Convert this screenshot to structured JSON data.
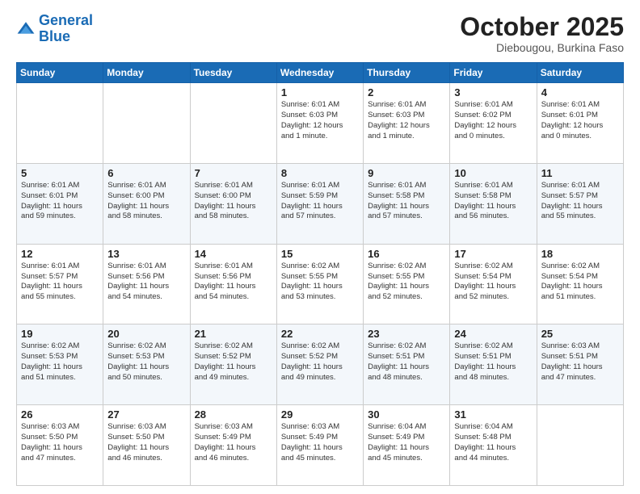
{
  "header": {
    "logo_line1": "General",
    "logo_line2": "Blue",
    "month_title": "October 2025",
    "location": "Diebougou, Burkina Faso"
  },
  "days_of_week": [
    "Sunday",
    "Monday",
    "Tuesday",
    "Wednesday",
    "Thursday",
    "Friday",
    "Saturday"
  ],
  "weeks": [
    [
      {
        "day": "",
        "info": ""
      },
      {
        "day": "",
        "info": ""
      },
      {
        "day": "",
        "info": ""
      },
      {
        "day": "1",
        "info": "Sunrise: 6:01 AM\nSunset: 6:03 PM\nDaylight: 12 hours\nand 1 minute."
      },
      {
        "day": "2",
        "info": "Sunrise: 6:01 AM\nSunset: 6:03 PM\nDaylight: 12 hours\nand 1 minute."
      },
      {
        "day": "3",
        "info": "Sunrise: 6:01 AM\nSunset: 6:02 PM\nDaylight: 12 hours\nand 0 minutes."
      },
      {
        "day": "4",
        "info": "Sunrise: 6:01 AM\nSunset: 6:01 PM\nDaylight: 12 hours\nand 0 minutes."
      }
    ],
    [
      {
        "day": "5",
        "info": "Sunrise: 6:01 AM\nSunset: 6:01 PM\nDaylight: 11 hours\nand 59 minutes."
      },
      {
        "day": "6",
        "info": "Sunrise: 6:01 AM\nSunset: 6:00 PM\nDaylight: 11 hours\nand 58 minutes."
      },
      {
        "day": "7",
        "info": "Sunrise: 6:01 AM\nSunset: 6:00 PM\nDaylight: 11 hours\nand 58 minutes."
      },
      {
        "day": "8",
        "info": "Sunrise: 6:01 AM\nSunset: 5:59 PM\nDaylight: 11 hours\nand 57 minutes."
      },
      {
        "day": "9",
        "info": "Sunrise: 6:01 AM\nSunset: 5:58 PM\nDaylight: 11 hours\nand 57 minutes."
      },
      {
        "day": "10",
        "info": "Sunrise: 6:01 AM\nSunset: 5:58 PM\nDaylight: 11 hours\nand 56 minutes."
      },
      {
        "day": "11",
        "info": "Sunrise: 6:01 AM\nSunset: 5:57 PM\nDaylight: 11 hours\nand 55 minutes."
      }
    ],
    [
      {
        "day": "12",
        "info": "Sunrise: 6:01 AM\nSunset: 5:57 PM\nDaylight: 11 hours\nand 55 minutes."
      },
      {
        "day": "13",
        "info": "Sunrise: 6:01 AM\nSunset: 5:56 PM\nDaylight: 11 hours\nand 54 minutes."
      },
      {
        "day": "14",
        "info": "Sunrise: 6:01 AM\nSunset: 5:56 PM\nDaylight: 11 hours\nand 54 minutes."
      },
      {
        "day": "15",
        "info": "Sunrise: 6:02 AM\nSunset: 5:55 PM\nDaylight: 11 hours\nand 53 minutes."
      },
      {
        "day": "16",
        "info": "Sunrise: 6:02 AM\nSunset: 5:55 PM\nDaylight: 11 hours\nand 52 minutes."
      },
      {
        "day": "17",
        "info": "Sunrise: 6:02 AM\nSunset: 5:54 PM\nDaylight: 11 hours\nand 52 minutes."
      },
      {
        "day": "18",
        "info": "Sunrise: 6:02 AM\nSunset: 5:54 PM\nDaylight: 11 hours\nand 51 minutes."
      }
    ],
    [
      {
        "day": "19",
        "info": "Sunrise: 6:02 AM\nSunset: 5:53 PM\nDaylight: 11 hours\nand 51 minutes."
      },
      {
        "day": "20",
        "info": "Sunrise: 6:02 AM\nSunset: 5:53 PM\nDaylight: 11 hours\nand 50 minutes."
      },
      {
        "day": "21",
        "info": "Sunrise: 6:02 AM\nSunset: 5:52 PM\nDaylight: 11 hours\nand 49 minutes."
      },
      {
        "day": "22",
        "info": "Sunrise: 6:02 AM\nSunset: 5:52 PM\nDaylight: 11 hours\nand 49 minutes."
      },
      {
        "day": "23",
        "info": "Sunrise: 6:02 AM\nSunset: 5:51 PM\nDaylight: 11 hours\nand 48 minutes."
      },
      {
        "day": "24",
        "info": "Sunrise: 6:02 AM\nSunset: 5:51 PM\nDaylight: 11 hours\nand 48 minutes."
      },
      {
        "day": "25",
        "info": "Sunrise: 6:03 AM\nSunset: 5:51 PM\nDaylight: 11 hours\nand 47 minutes."
      }
    ],
    [
      {
        "day": "26",
        "info": "Sunrise: 6:03 AM\nSunset: 5:50 PM\nDaylight: 11 hours\nand 47 minutes."
      },
      {
        "day": "27",
        "info": "Sunrise: 6:03 AM\nSunset: 5:50 PM\nDaylight: 11 hours\nand 46 minutes."
      },
      {
        "day": "28",
        "info": "Sunrise: 6:03 AM\nSunset: 5:49 PM\nDaylight: 11 hours\nand 46 minutes."
      },
      {
        "day": "29",
        "info": "Sunrise: 6:03 AM\nSunset: 5:49 PM\nDaylight: 11 hours\nand 45 minutes."
      },
      {
        "day": "30",
        "info": "Sunrise: 6:04 AM\nSunset: 5:49 PM\nDaylight: 11 hours\nand 45 minutes."
      },
      {
        "day": "31",
        "info": "Sunrise: 6:04 AM\nSunset: 5:48 PM\nDaylight: 11 hours\nand 44 minutes."
      },
      {
        "day": "",
        "info": ""
      }
    ]
  ]
}
